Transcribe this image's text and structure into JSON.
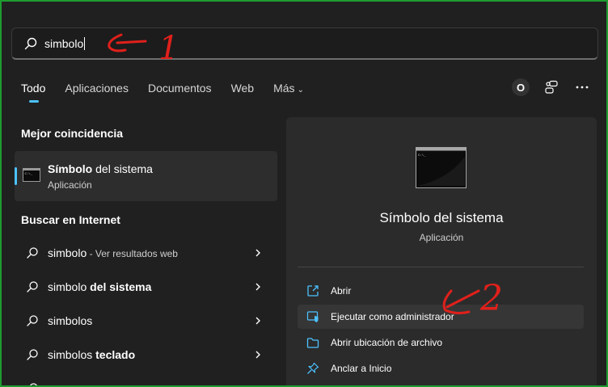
{
  "search": {
    "value": "simbolo"
  },
  "tabs": [
    {
      "label": "Todo",
      "active": true
    },
    {
      "label": "Aplicaciones"
    },
    {
      "label": "Documentos"
    },
    {
      "label": "Web"
    },
    {
      "label": "Más"
    }
  ],
  "top_icons": {
    "account_letter": "O"
  },
  "best_match": {
    "heading": "Mejor coincidencia",
    "title_bold": "Símbolo",
    "title_rest": " del sistema",
    "subtitle": "Aplicación"
  },
  "web_search": {
    "heading": "Buscar en Internet",
    "items": [
      {
        "plain": "simbolo",
        "bold": "",
        "hint": " - Ver resultados web"
      },
      {
        "plain": "simbolo ",
        "bold": "del sistema",
        "hint": ""
      },
      {
        "plain": "simbolos",
        "bold": "",
        "hint": ""
      },
      {
        "plain": "simbolos ",
        "bold": "teclado",
        "hint": ""
      }
    ]
  },
  "preview": {
    "title": "Símbolo del sistema",
    "subtitle": "Aplicación",
    "actions": [
      {
        "label": "Abrir",
        "icon": "open-icon"
      },
      {
        "label": "Ejecutar como administrador",
        "icon": "shield-icon"
      },
      {
        "label": "Abrir ubicación de archivo",
        "icon": "folder-icon"
      },
      {
        "label": "Anclar a Inicio",
        "icon": "pin-icon"
      }
    ]
  },
  "annotations": {
    "one": "1",
    "two": "2"
  },
  "colors": {
    "accent": "#4cc2ff",
    "annotation": "#e0201b",
    "frame": "#1e9b2f"
  }
}
